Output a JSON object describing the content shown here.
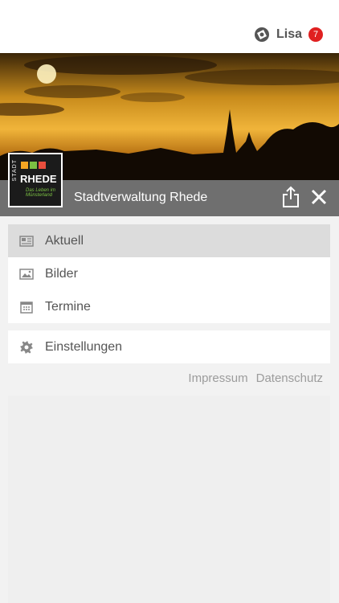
{
  "header": {
    "user_name": "Lisa",
    "notification_count": "7"
  },
  "organization": {
    "title": "Stadtverwaltung Rhede",
    "logo": {
      "vertical_text": "STADT",
      "name": "RHEDE",
      "slogan": "Das Leben im Münsterland"
    }
  },
  "menu": {
    "items": [
      {
        "label": "Aktuell",
        "icon": "newspaper-icon",
        "active": true
      },
      {
        "label": "Bilder",
        "icon": "image-icon",
        "active": false
      },
      {
        "label": "Termine",
        "icon": "calendar-icon",
        "active": false
      }
    ],
    "settings": {
      "label": "Einstellungen",
      "icon": "gear-icon"
    }
  },
  "footer": {
    "impressum": "Impressum",
    "datenschutz": "Datenschutz"
  },
  "colors": {
    "badge": "#e02020",
    "titlebar": "#6f6f6f",
    "active_item": "#dcdcdc",
    "text": "#555555"
  }
}
